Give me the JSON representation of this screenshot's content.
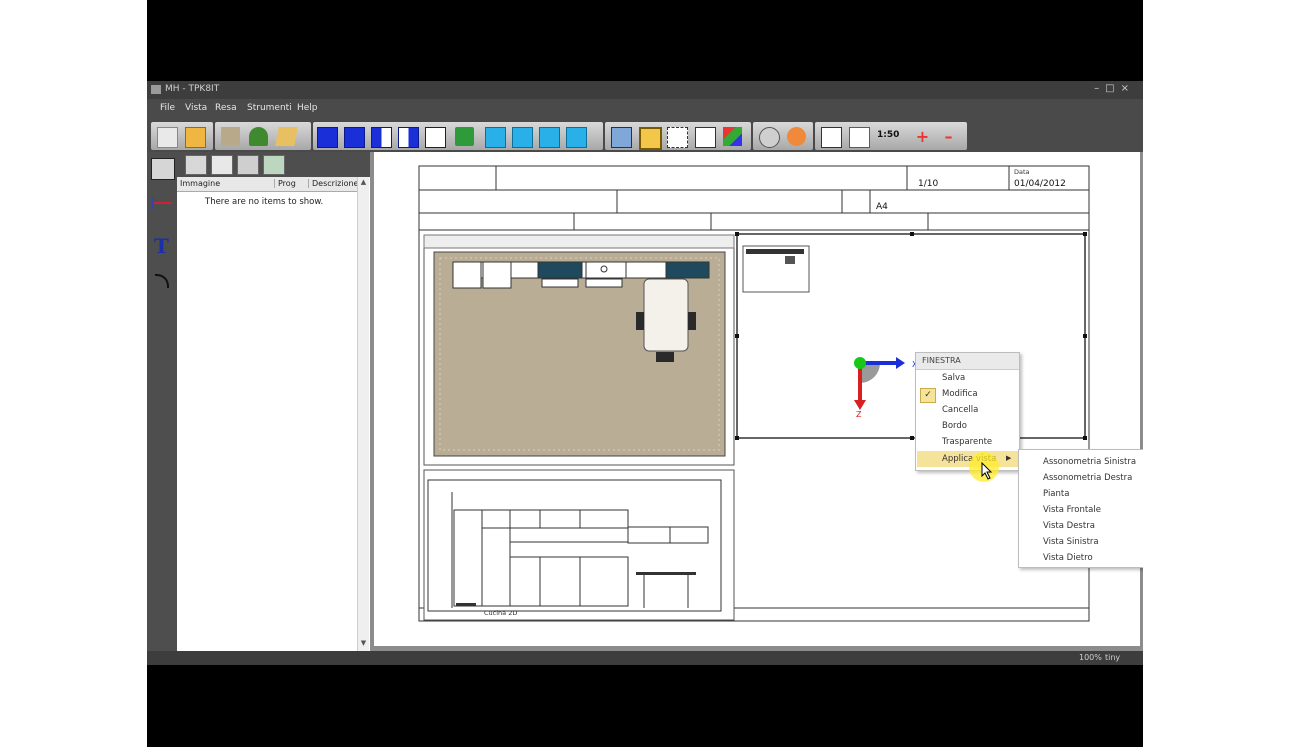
{
  "window": {
    "title": "MH - TPK8IT"
  },
  "menu": {
    "items": [
      "File",
      "Vista",
      "Resa",
      "Strumenti",
      "Help"
    ]
  },
  "toolbar": {
    "scale_label": "1:50"
  },
  "sidebar": {
    "columns": [
      "Immagine",
      "Prog",
      "Descrizione"
    ],
    "empty_message": "There are no items to show."
  },
  "sheet": {
    "header": {
      "date_label": "Data",
      "date_value": "01/04/2012",
      "number_value": "1/10",
      "format_value": "A4",
      "mid_value": "Cucina 2D"
    }
  },
  "context_menu": {
    "title": "FINESTRA",
    "items": [
      "Salva",
      "Modifica",
      "Cancella",
      "Bordo",
      "Trasparente",
      "Applica vista"
    ],
    "checked_item": "Modifica",
    "highlighted_item": "Applica vista"
  },
  "submenu": {
    "items": [
      "Assonometria Sinistra",
      "Assonometria Destra",
      "Pianta",
      "Vista Frontale",
      "Vista Destra",
      "Vista Sinistra",
      "Vista Dietro"
    ]
  },
  "axis_labels": {
    "x": "X",
    "z": "Z"
  },
  "status": {
    "zoom": "100%",
    "units": "tiny"
  },
  "colors": {
    "accent_highlight": "#f6e39a",
    "panel_dark": "#4a4a4a",
    "counter_blue": "#1f4a5e",
    "floor": "#b9ad96"
  }
}
